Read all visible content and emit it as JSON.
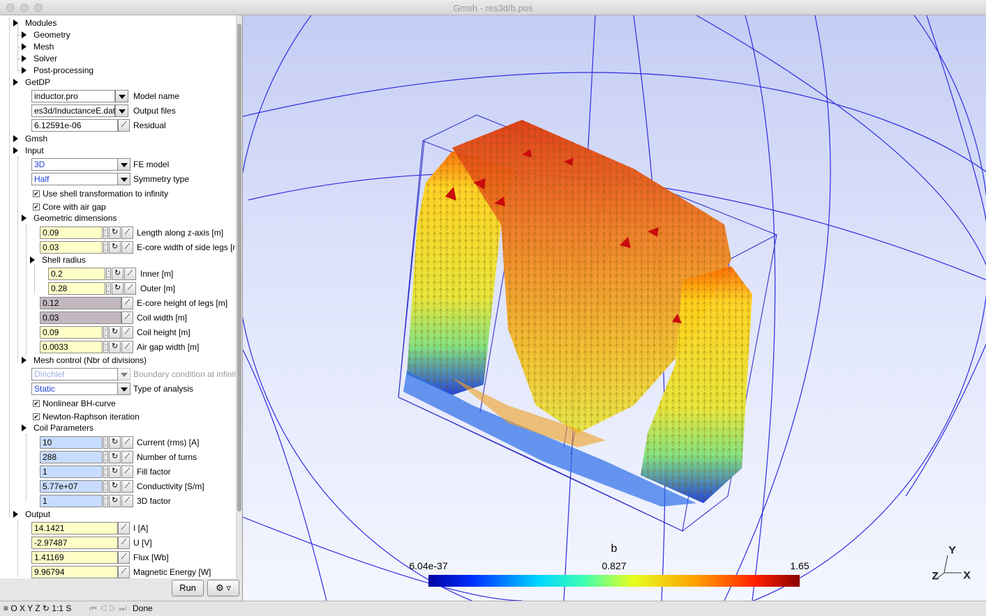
{
  "window": {
    "title": "Gmsh - res3d/b.pos"
  },
  "tree": {
    "modules": "Modules",
    "geometry": "Geometry",
    "mesh": "Mesh",
    "solver": "Solver",
    "post_processing": "Post-processing",
    "getdp": "GetDP",
    "model_name": {
      "value": "inductor.pro",
      "label": "Model name"
    },
    "output_files": {
      "value": "es3d/InductanceE.dat",
      "label": "Output files"
    },
    "residual": {
      "value": "6.12591e-06",
      "label": "Residual"
    },
    "gmsh": "Gmsh",
    "input": "Input",
    "fe_model": {
      "value": "3D",
      "label": "FE model"
    },
    "symmetry": {
      "value": "Half",
      "label": "Symmetry type"
    },
    "shell_transform": {
      "label": "Use shell transformation to infinity",
      "checked": true
    },
    "core_air_gap": {
      "label": "Core with air gap",
      "checked": true
    },
    "geometric_dimensions": "Geometric dimensions",
    "length_z": {
      "value": "0.09",
      "label": "Length along z-axis [m]"
    },
    "ecore_width": {
      "value": "0.03",
      "label": "E-core width of side legs [m]"
    },
    "shell_radius": "Shell radius",
    "inner": {
      "value": "0.2",
      "label": "Inner [m]"
    },
    "outer": {
      "value": "0.28",
      "label": "Outer [m]"
    },
    "ecore_height": {
      "value": "0.12",
      "label": "E-core height of legs [m]"
    },
    "coil_width": {
      "value": "0.03",
      "label": "Coil width [m]"
    },
    "coil_height": {
      "value": "0.09",
      "label": "Coil height [m]"
    },
    "air_gap": {
      "value": "0.0033",
      "label": "Air gap width [m]"
    },
    "mesh_control": "Mesh control (Nbr of divisions)",
    "boundary": {
      "value": "Dirichlet",
      "label": "Boundary condition at infinity"
    },
    "analysis": {
      "value": "Static",
      "label": "Type of analysis"
    },
    "nonlinear": {
      "label": "Nonlinear BH-curve",
      "checked": true
    },
    "newton": {
      "label": "Newton-Raphson iteration",
      "checked": true
    },
    "coil_parameters": "Coil Parameters",
    "current": {
      "value": "10",
      "label": "Current (rms) [A]"
    },
    "turns": {
      "value": "288",
      "label": "Number of turns"
    },
    "fill": {
      "value": "1",
      "label": "Fill factor"
    },
    "conductivity": {
      "value": "5.77e+07",
      "label": "Conductivity [S/m]"
    },
    "factor3d": {
      "value": "1",
      "label": "3D factor"
    },
    "output": "Output",
    "i": {
      "value": "14.1421",
      "label": "I [A]"
    },
    "u": {
      "value": "-2.97487",
      "label": "U [V]"
    },
    "flux": {
      "value": "1.41169",
      "label": "Flux [Wb]"
    },
    "energy": {
      "value": "9.96794",
      "label": "Magnetic Energy [W]"
    }
  },
  "buttons": {
    "run": "Run",
    "options": "⚙ ▿"
  },
  "viewport": {
    "scale_title": "b",
    "scale_min": "6.04e-37",
    "scale_mid": "0.827",
    "scale_max": "1.65",
    "axes": {
      "x": "X",
      "y": "Y",
      "z": "Z"
    }
  },
  "status": {
    "toolbar": "≡ O X Y Z ↻ 1:1 S",
    "nav": "⏮ ◁ ▷ ⏭",
    "message": "Done"
  },
  "colors": {
    "accent_blue": "#1a3ed8",
    "input_yellow": "#ffffc8",
    "input_blue": "#c8dcff",
    "input_gray": "#c3b8c0"
  }
}
